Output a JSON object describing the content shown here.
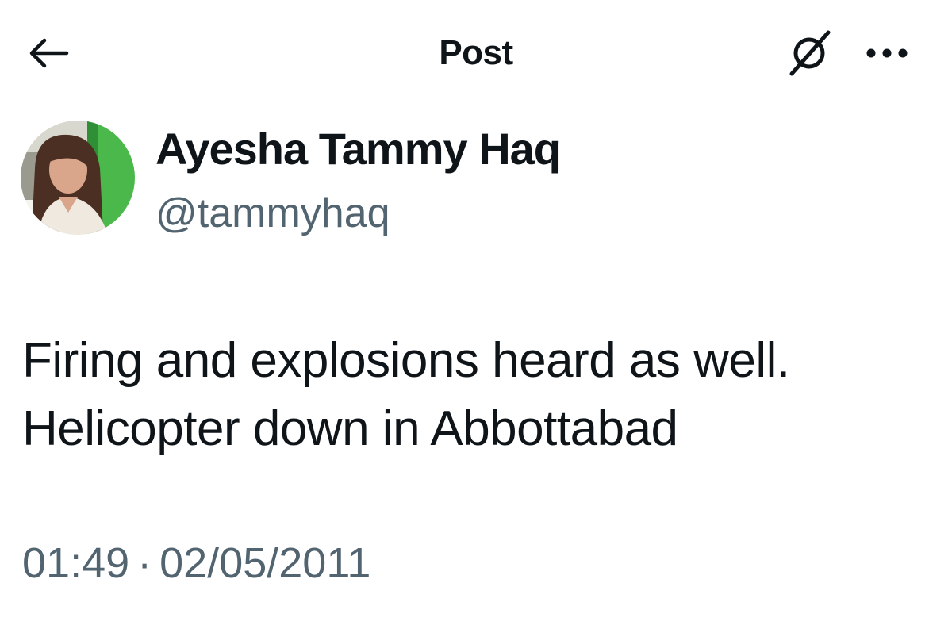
{
  "header": {
    "title": "Post",
    "back_icon": "arrow-left-icon",
    "grok_icon": "grok-icon",
    "more_icon": "more-horizontal-icon"
  },
  "author": {
    "display_name": "Ayesha Tammy Haq",
    "handle": "@tammyhaq"
  },
  "tweet": {
    "lines": [
      "Firing and explosions heard as well.",
      "Helicopter down in Abbottabad"
    ],
    "time": "01:49",
    "separator": "·",
    "date": "02/05/2011"
  },
  "colors": {
    "text": "#0f1419",
    "secondary": "#536471",
    "background": "#ffffff"
  }
}
